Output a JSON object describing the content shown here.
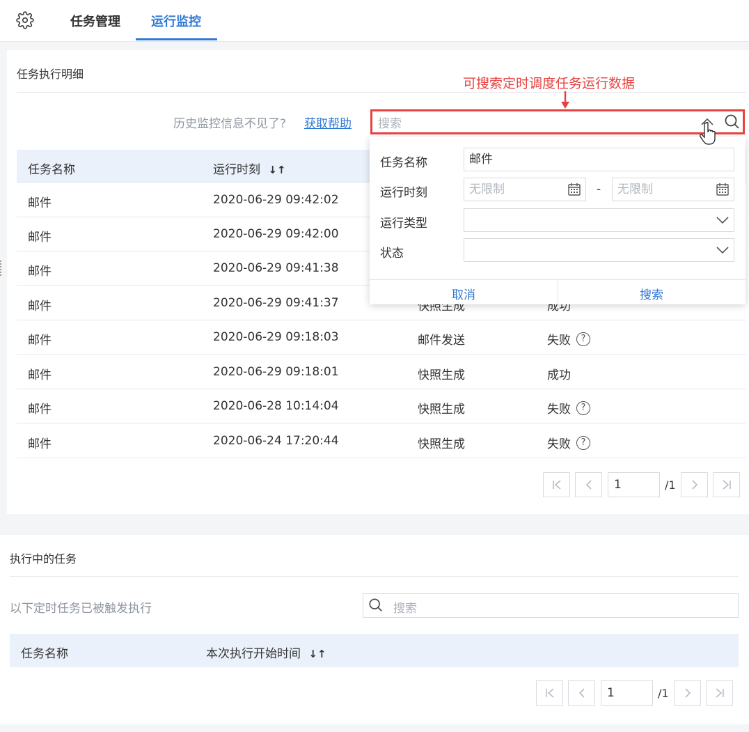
{
  "tabs": [
    {
      "label": "任务管理",
      "active": false
    },
    {
      "label": "运行监控",
      "active": true
    }
  ],
  "detail": {
    "title": "任务执行明细",
    "help_text": "历史监控信息不见了?",
    "help_link": "获取帮助",
    "search_placeholder": "搜索",
    "annotation": "可搜索定时调度任务运行数据",
    "columns": [
      "任务名称",
      "运行时刻"
    ],
    "rows": [
      {
        "name": "邮件",
        "time": "2020-06-29 09:42:02",
        "type": "",
        "status": ""
      },
      {
        "name": "邮件",
        "time": "2020-06-29 09:42:00",
        "type": "",
        "status": ""
      },
      {
        "name": "邮件",
        "time": "2020-06-29 09:41:38",
        "type": "",
        "status": ""
      },
      {
        "name": "邮件",
        "time": "2020-06-29 09:41:37",
        "type": "快照生成",
        "status": "成功"
      },
      {
        "name": "邮件",
        "time": "2020-06-29 09:18:03",
        "type": "邮件发送",
        "status": "失败"
      },
      {
        "name": "邮件",
        "time": "2020-06-29 09:18:01",
        "type": "快照生成",
        "status": "成功"
      },
      {
        "name": "邮件",
        "time": "2020-06-28 10:14:04",
        "type": "快照生成",
        "status": "失败"
      },
      {
        "name": "邮件",
        "time": "2020-06-24 17:20:44",
        "type": "快照生成",
        "status": "失败"
      }
    ],
    "pagination": {
      "page": "1",
      "total": "/1"
    }
  },
  "filter": {
    "name_label": "任务名称",
    "name_value": "邮件",
    "time_label": "运行时刻",
    "time_from_placeholder": "无限制",
    "time_sep": "-",
    "time_to_placeholder": "无限制",
    "type_label": "运行类型",
    "status_label": "状态",
    "cancel": "取消",
    "search": "搜索"
  },
  "running": {
    "title": "执行中的任务",
    "subtitle": "以下定时任务已被触发执行",
    "search_placeholder": "搜索",
    "columns": [
      "任务名称",
      "本次执行开始时间"
    ],
    "pagination": {
      "page": "1",
      "total": "/1"
    }
  },
  "colors": {
    "accent": "#2e78d6",
    "highlight": "#e64340",
    "header_bg": "#eaf1fb"
  }
}
